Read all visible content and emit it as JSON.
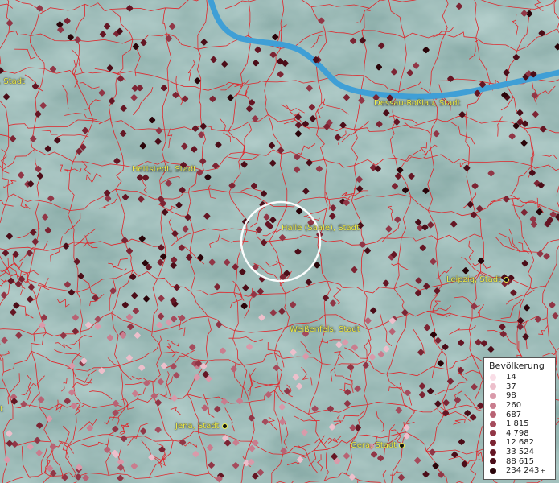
{
  "map": {
    "river_color": "#3f9fd6",
    "border_color": "#e0252a",
    "selection_ring": "circle"
  },
  "cities": [
    {
      "name": "Dessau-Roßlau, Stadt"
    },
    {
      "name": "Hettstedt, Stadt"
    },
    {
      "name": "Halle (Saale), Stadt"
    },
    {
      "name": "Leipzig, Stadt"
    },
    {
      "name": "Weißenfels, Stadt"
    },
    {
      "name": "Jena, Stadt"
    },
    {
      "name": "Gera, Stadt"
    },
    {
      "name": ", Stadt"
    },
    {
      "name": "t"
    }
  ],
  "legend": {
    "title": "Bevölkerung",
    "entries": [
      {
        "label": "14",
        "color": "#f9dde6"
      },
      {
        "label": "37",
        "color": "#ecbfcb"
      },
      {
        "label": "98",
        "color": "#d99aaa"
      },
      {
        "label": "260",
        "color": "#c97d8e"
      },
      {
        "label": "687",
        "color": "#b86273"
      },
      {
        "label": "1 815",
        "color": "#a54b5c"
      },
      {
        "label": "4 798",
        "color": "#913646"
      },
      {
        "label": "12 682",
        "color": "#7c2433"
      },
      {
        "label": "33 524",
        "color": "#651624"
      },
      {
        "label": "88 615",
        "color": "#4b0d18"
      },
      {
        "label": "234 243",
        "color": "#2a0409"
      }
    ],
    "plus": "+"
  }
}
